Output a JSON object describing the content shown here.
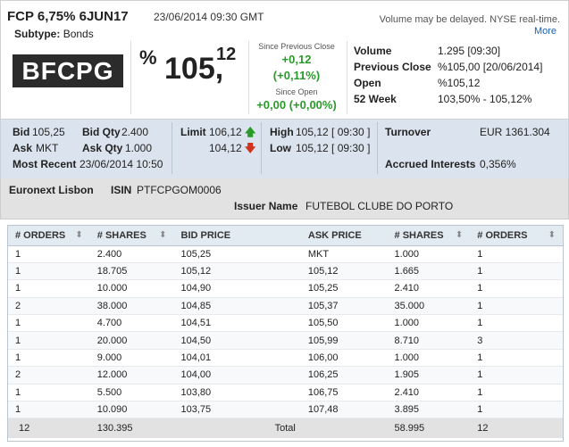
{
  "header": {
    "title": "FCP 6,75% 6JUN17",
    "datetime": "23/06/2014 09:30 GMT",
    "subtype_label": "Subtype:",
    "subtype_value": "Bonds",
    "delayed_notice": "Volume may be delayed. NYSE real-time.",
    "more_link": "More",
    "ticker": "BFCPG"
  },
  "price": {
    "pct_sign": "%",
    "main": "105,",
    "decimals": "12",
    "since_prev_close_label": "Since Previous Close",
    "since_prev_close_value": "+0,12",
    "since_prev_close_pct": "(+0,11%)",
    "since_open_label": "Since Open",
    "since_open_value": "+0,00 (+0,00%)"
  },
  "summary": {
    "volume_label": "Volume",
    "volume_value": "1.295 [09:30]",
    "prev_close_label": "Previous Close",
    "prev_close_value": "%105,00 [20/06/2014]",
    "open_label": "Open",
    "open_value": "%105,12",
    "week52_label": "52 Week",
    "week52_value": "103,50% - 105,12%"
  },
  "quote": {
    "bid_label": "Bid",
    "bid_value": "105,25",
    "bid_qty_label": "Bid Qty",
    "bid_qty_value": "2.400",
    "ask_label": "Ask",
    "ask_value": "MKT",
    "ask_qty_label": "Ask Qty",
    "ask_qty_value": "1.000",
    "most_recent_label": "Most Recent",
    "most_recent_value": "23/06/2014 10:50",
    "limit_label": "Limit",
    "limit_up_value": "106,12",
    "limit_down_value": "104,12",
    "high_label": "High",
    "high_value": "105,12 [ 09:30 ]",
    "low_label": "Low",
    "low_value": "105,12 [ 09:30 ]",
    "turnover_label": "Turnover",
    "turnover_value": "EUR 1361.304",
    "accrued_label": "Accrued Interests",
    "accrued_value": "0,356%"
  },
  "issuer": {
    "market": "Euronext Lisbon",
    "isin_label": "ISIN",
    "isin_value": "PTFCPGOM0006",
    "issuer_name_label": "Issuer Name",
    "issuer_name_value": "FUTEBOL CLUBE DO PORTO"
  },
  "orderbook": {
    "columns": [
      "# ORDERS",
      "# SHARES",
      "BID PRICE",
      "ASK PRICE",
      "# SHARES",
      "# ORDERS"
    ],
    "rows": [
      [
        "1",
        "2.400",
        "105,25",
        "MKT",
        "1.000",
        "1"
      ],
      [
        "1",
        "18.705",
        "105,12",
        "105,12",
        "1.665",
        "1"
      ],
      [
        "1",
        "10.000",
        "104,90",
        "105,25",
        "2.410",
        "1"
      ],
      [
        "2",
        "38.000",
        "104,85",
        "105,37",
        "35.000",
        "1"
      ],
      [
        "1",
        "4.700",
        "104,51",
        "105,50",
        "1.000",
        "1"
      ],
      [
        "1",
        "20.000",
        "104,50",
        "105,99",
        "8.710",
        "3"
      ],
      [
        "1",
        "9.000",
        "104,01",
        "106,00",
        "1.000",
        "1"
      ],
      [
        "2",
        "12.000",
        "104,00",
        "106,25",
        "1.905",
        "1"
      ],
      [
        "1",
        "5.500",
        "103,80",
        "106,75",
        "2.410",
        "1"
      ],
      [
        "1",
        "10.090",
        "103,75",
        "107,48",
        "3.895",
        "1"
      ]
    ],
    "footer": {
      "bid_orders": "12",
      "bid_shares": "130.395",
      "total_label": "Total",
      "ask_shares": "58.995",
      "ask_orders": "12"
    }
  }
}
